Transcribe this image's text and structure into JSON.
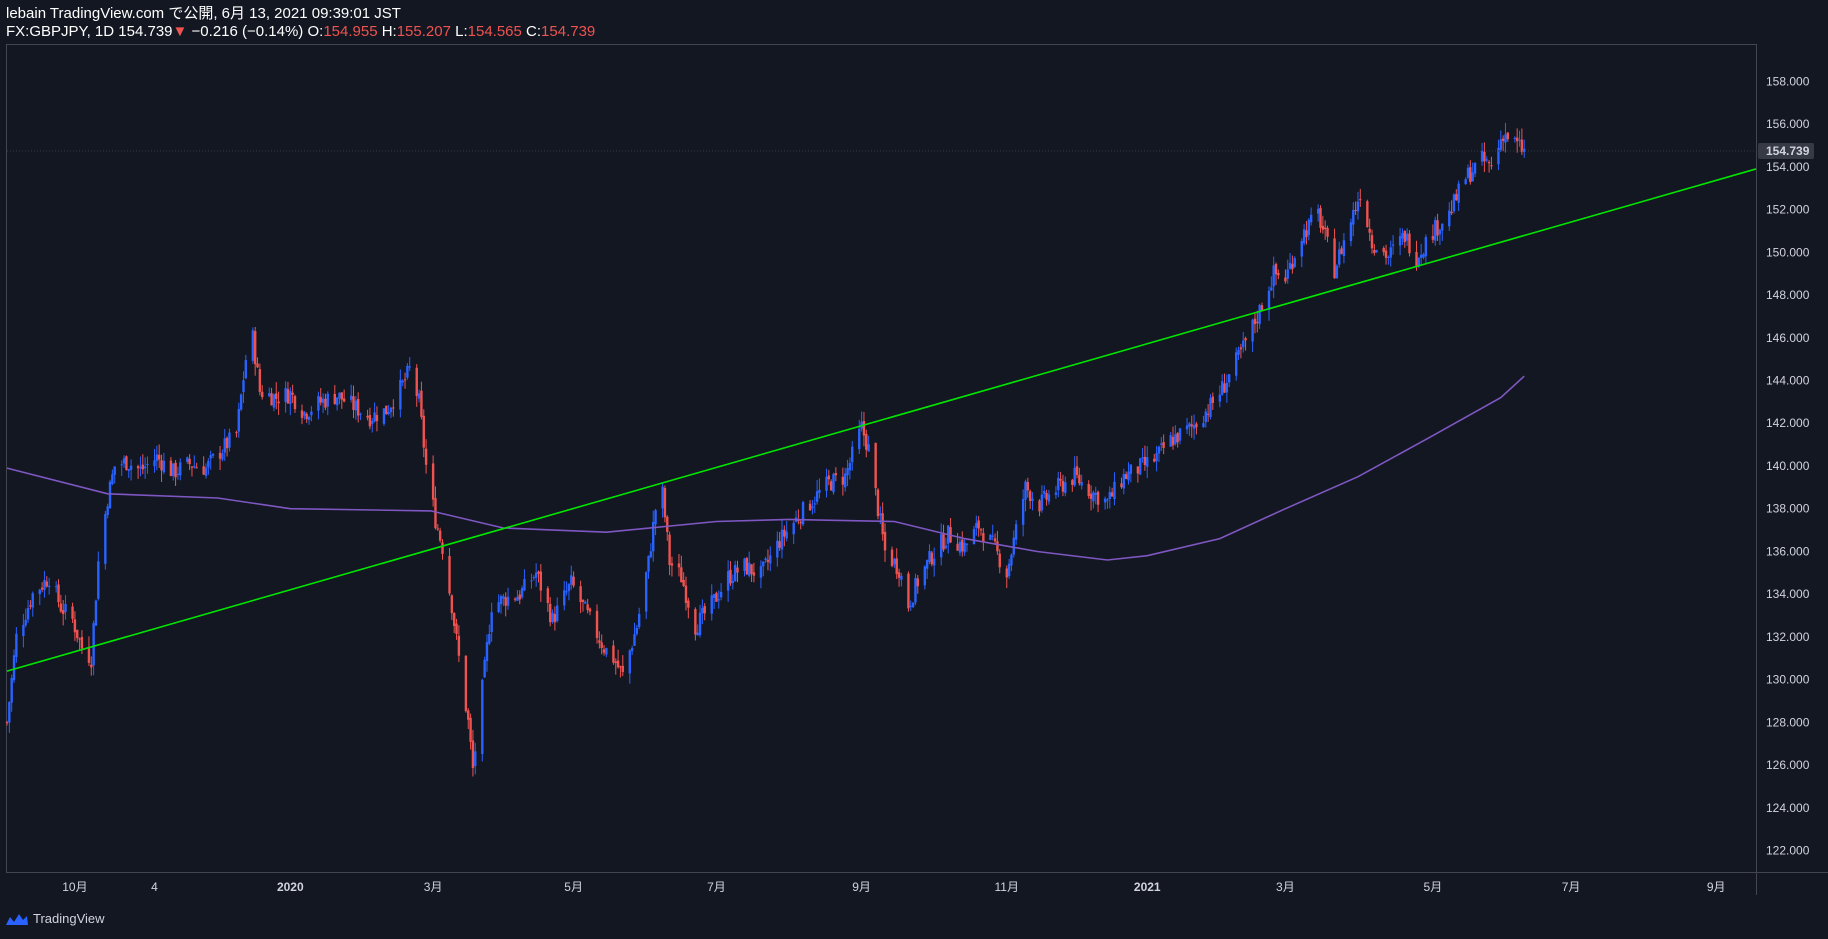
{
  "header": {
    "line1": "lebain TradingView.com で公開, 6月 13, 2021 09:39:01 JST",
    "symbol": "FX:GBPJPY, 1D",
    "last": "154.739",
    "arrow": "▼",
    "change": "−0.216 (−0.14%)",
    "o_label": "O:",
    "o": "154.955",
    "h_label": "H:",
    "h": "155.207",
    "l_label": "L:",
    "l": "154.565",
    "c_label": "C:",
    "c": "154.739"
  },
  "footer": {
    "brand": "TradingView"
  },
  "colors": {
    "background": "#131722",
    "up": "#2962ff",
    "down": "#ef5350",
    "trendline": "#00e600",
    "moving_average": "#7e57c2",
    "last_price_tag": "#363a45"
  },
  "chart_data": {
    "type": "candlestick",
    "symbol": "GBPJPY",
    "interval": "1D",
    "ylim": [
      121,
      159.7
    ],
    "yticks": [
      "122.000",
      "124.000",
      "126.000",
      "128.000",
      "130.000",
      "132.000",
      "134.000",
      "136.000",
      "138.000",
      "140.000",
      "142.000",
      "144.000",
      "146.000",
      "148.000",
      "150.000",
      "152.000",
      "154.000",
      "156.000",
      "158.000"
    ],
    "last_price_label": "154.739",
    "last_price": 154.739,
    "xticks": [
      {
        "label": "10月",
        "date": "2019-10-01",
        "bold": false
      },
      {
        "label": "4",
        "date": "2019-11-04",
        "bold": false
      },
      {
        "label": "2020",
        "date": "2020-01-01",
        "bold": true
      },
      {
        "label": "3月",
        "date": "2020-03-02",
        "bold": false
      },
      {
        "label": "5月",
        "date": "2020-05-01",
        "bold": false
      },
      {
        "label": "7月",
        "date": "2020-07-01",
        "bold": false
      },
      {
        "label": "9月",
        "date": "2020-09-01",
        "bold": false
      },
      {
        "label": "11月",
        "date": "2020-11-02",
        "bold": false
      },
      {
        "label": "2021",
        "date": "2021-01-01",
        "bold": true
      },
      {
        "label": "3月",
        "date": "2021-03-01",
        "bold": false
      },
      {
        "label": "5月",
        "date": "2021-05-03",
        "bold": false
      },
      {
        "label": "7月",
        "date": "2021-07-01",
        "bold": false
      },
      {
        "label": "9月",
        "date": "2021-09-01",
        "bold": false
      }
    ],
    "xrange": [
      "2019-09-02",
      "2021-09-18"
    ],
    "close_path": [
      [
        "2019-09-02",
        128.0
      ],
      [
        "2019-09-06",
        132.0
      ],
      [
        "2019-09-13",
        134.0
      ],
      [
        "2019-09-20",
        134.8
      ],
      [
        "2019-09-25",
        133.4
      ],
      [
        "2019-09-30",
        132.8
      ],
      [
        "2019-10-04",
        131.5
      ],
      [
        "2019-10-08",
        131.0
      ],
      [
        "2019-10-11",
        135.5
      ],
      [
        "2019-10-15",
        138.5
      ],
      [
        "2019-10-18",
        140.0
      ],
      [
        "2019-10-23",
        140.2
      ],
      [
        "2019-10-29",
        139.8
      ],
      [
        "2019-11-05",
        140.4
      ],
      [
        "2019-11-12",
        139.7
      ],
      [
        "2019-11-19",
        140.1
      ],
      [
        "2019-11-26",
        139.9
      ],
      [
        "2019-12-03",
        140.8
      ],
      [
        "2019-12-09",
        141.5
      ],
      [
        "2019-12-13",
        145.0
      ],
      [
        "2019-12-16",
        146.0
      ],
      [
        "2019-12-19",
        143.5
      ],
      [
        "2019-12-26",
        143.2
      ],
      [
        "2020-01-01",
        143.4
      ],
      [
        "2020-01-07",
        142.5
      ],
      [
        "2020-01-14",
        143.0
      ],
      [
        "2020-01-21",
        143.3
      ],
      [
        "2020-01-28",
        142.8
      ],
      [
        "2020-02-04",
        142.3
      ],
      [
        "2020-02-11",
        142.6
      ],
      [
        "2020-02-18",
        143.8
      ],
      [
        "2020-02-21",
        144.5
      ],
      [
        "2020-02-25",
        143.0
      ],
      [
        "2020-02-28",
        140.0
      ],
      [
        "2020-03-03",
        137.5
      ],
      [
        "2020-03-06",
        136.2
      ],
      [
        "2020-03-10",
        133.5
      ],
      [
        "2020-03-13",
        131.0
      ],
      [
        "2020-03-17",
        128.0
      ],
      [
        "2020-03-19",
        125.8
      ],
      [
        "2020-03-24",
        130.5
      ],
      [
        "2020-03-27",
        133.5
      ],
      [
        "2020-04-02",
        133.8
      ],
      [
        "2020-04-08",
        134.0
      ],
      [
        "2020-04-15",
        135.0
      ],
      [
        "2020-04-22",
        132.8
      ],
      [
        "2020-04-30",
        134.5
      ],
      [
        "2020-05-07",
        133.0
      ],
      [
        "2020-05-14",
        131.5
      ],
      [
        "2020-05-18",
        131.0
      ],
      [
        "2020-05-22",
        130.2
      ],
      [
        "2020-05-28",
        132.5
      ],
      [
        "2020-06-02",
        135.5
      ],
      [
        "2020-06-05",
        138.0
      ],
      [
        "2020-06-08",
        138.7
      ],
      [
        "2020-06-11",
        135.5
      ],
      [
        "2020-06-16",
        134.8
      ],
      [
        "2020-06-22",
        132.5
      ],
      [
        "2020-06-29",
        133.5
      ],
      [
        "2020-07-06",
        134.8
      ],
      [
        "2020-07-13",
        135.3
      ],
      [
        "2020-07-20",
        134.9
      ],
      [
        "2020-07-28",
        136.5
      ],
      [
        "2020-08-04",
        137.5
      ],
      [
        "2020-08-11",
        138.4
      ],
      [
        "2020-08-18",
        139.2
      ],
      [
        "2020-08-25",
        139.5
      ],
      [
        "2020-09-01",
        141.8
      ],
      [
        "2020-09-04",
        140.8
      ],
      [
        "2020-09-08",
        138.0
      ],
      [
        "2020-09-11",
        136.0
      ],
      [
        "2020-09-17",
        135.2
      ],
      [
        "2020-09-21",
        133.5
      ],
      [
        "2020-09-25",
        134.6
      ],
      [
        "2020-10-01",
        135.8
      ],
      [
        "2020-10-08",
        136.8
      ],
      [
        "2020-10-15",
        136.2
      ],
      [
        "2020-10-21",
        137.2
      ],
      [
        "2020-10-27",
        136.3
      ],
      [
        "2020-11-02",
        135.0
      ],
      [
        "2020-11-05",
        136.5
      ],
      [
        "2020-11-10",
        139.0
      ],
      [
        "2020-11-16",
        138.2
      ],
      [
        "2020-11-24",
        139.0
      ],
      [
        "2020-12-01",
        139.5
      ],
      [
        "2020-12-08",
        138.8
      ],
      [
        "2020-12-15",
        138.3
      ],
      [
        "2020-12-22",
        139.5
      ],
      [
        "2021-01-04",
        140.3
      ],
      [
        "2021-01-11",
        141.2
      ],
      [
        "2021-01-20",
        141.8
      ],
      [
        "2021-01-28",
        142.8
      ],
      [
        "2021-02-03",
        143.8
      ],
      [
        "2021-02-10",
        145.3
      ],
      [
        "2021-02-17",
        147.0
      ],
      [
        "2021-02-24",
        149.0
      ],
      [
        "2021-03-01",
        148.8
      ],
      [
        "2021-03-08",
        150.8
      ],
      [
        "2021-03-15",
        151.8
      ],
      [
        "2021-03-22",
        149.2
      ],
      [
        "2021-03-29",
        151.5
      ],
      [
        "2021-04-02",
        152.8
      ],
      [
        "2021-04-07",
        150.5
      ],
      [
        "2021-04-14",
        149.8
      ],
      [
        "2021-04-21",
        150.8
      ],
      [
        "2021-04-26",
        149.8
      ],
      [
        "2021-05-03",
        151.0
      ],
      [
        "2021-05-10",
        151.8
      ],
      [
        "2021-05-17",
        153.5
      ],
      [
        "2021-05-24",
        154.3
      ],
      [
        "2021-05-28",
        154.0
      ],
      [
        "2021-06-02",
        155.6
      ],
      [
        "2021-06-06",
        155.2
      ],
      [
        "2021-06-11",
        154.74
      ]
    ],
    "trendline": {
      "from": [
        "2019-09-02",
        130.4
      ],
      "to": [
        "2021-09-18",
        153.9
      ]
    },
    "moving_average": [
      [
        "2019-09-02",
        139.9
      ],
      [
        "2019-10-15",
        138.7
      ],
      [
        "2019-12-01",
        138.5
      ],
      [
        "2020-01-01",
        138.0
      ],
      [
        "2020-03-01",
        137.9
      ],
      [
        "2020-04-01",
        137.1
      ],
      [
        "2020-05-15",
        136.9
      ],
      [
        "2020-07-01",
        137.4
      ],
      [
        "2020-08-01",
        137.5
      ],
      [
        "2020-09-15",
        137.4
      ],
      [
        "2020-10-15",
        136.6
      ],
      [
        "2020-11-15",
        136.0
      ],
      [
        "2020-12-15",
        135.6
      ],
      [
        "2021-01-01",
        135.8
      ],
      [
        "2021-02-01",
        136.6
      ],
      [
        "2021-03-01",
        138.0
      ],
      [
        "2021-04-01",
        139.5
      ],
      [
        "2021-05-01",
        141.3
      ],
      [
        "2021-06-01",
        143.2
      ],
      [
        "2021-06-11",
        144.2
      ]
    ]
  }
}
